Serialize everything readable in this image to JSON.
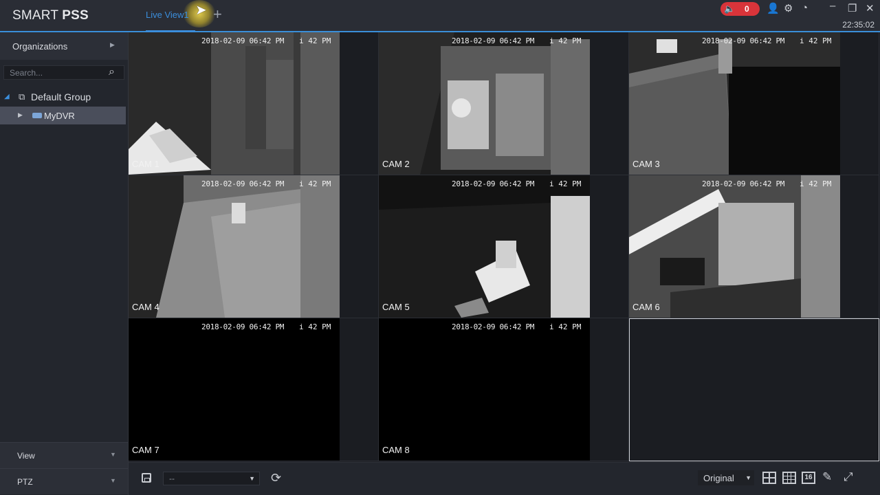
{
  "app": {
    "title_plain": "SMART ",
    "title_bold": "PSS"
  },
  "tabs": [
    {
      "label": "Live View1"
    }
  ],
  "header": {
    "alarm_count": "0",
    "clock": "22:35:02"
  },
  "sidebar": {
    "organizations_label": "Organizations",
    "search_placeholder": "Search...",
    "tree": {
      "group_label": "Default Group",
      "device_label": "MyDVR"
    },
    "view_label": "View",
    "ptz_label": "PTZ"
  },
  "cameras": [
    {
      "label": "CAM 1",
      "timestamp": "2018-02-09 06:42 PM",
      "pm": "i 42 PM"
    },
    {
      "label": "CAM 2",
      "timestamp": "2018-02-09 06:42 PM",
      "pm": "i 42 PM"
    },
    {
      "label": "CAM 3",
      "timestamp": "2018-02-09 06:42 PM",
      "pm": "i 42 PM"
    },
    {
      "label": "CAM 4",
      "timestamp": "2018-02-09 06:42 PM",
      "pm": "i 42 PM"
    },
    {
      "label": "CAM 5",
      "timestamp": "2018-02-09 06:42 PM",
      "pm": "i 42 PM"
    },
    {
      "label": "CAM 6",
      "timestamp": "2018-02-09 06:42 PM",
      "pm": "i 42 PM"
    },
    {
      "label": "CAM 7",
      "timestamp": "2018-02-09 06:42 PM",
      "pm": "i 42 PM"
    },
    {
      "label": "CAM 8",
      "timestamp": "2018-02-09 06:42 PM",
      "pm": "i 42 PM"
    }
  ],
  "toolbar": {
    "view_select_value": "--",
    "ratio_select_value": "Original",
    "layout_16_label": "16"
  },
  "colors": {
    "accent": "#3b8edc",
    "alarm": "#d9343a",
    "background": "#1f2128"
  },
  "icons": [
    "speaker-icon",
    "user-icon",
    "gear-icon",
    "performance-icon",
    "minimize-icon",
    "restore-icon",
    "close-icon",
    "search-icon",
    "org-tree-icon",
    "dvr-device-icon",
    "save-icon",
    "refresh-icon",
    "layout-4-icon",
    "layout-9-icon",
    "layout-16-icon",
    "edit-icon",
    "fullscreen-icon"
  ]
}
